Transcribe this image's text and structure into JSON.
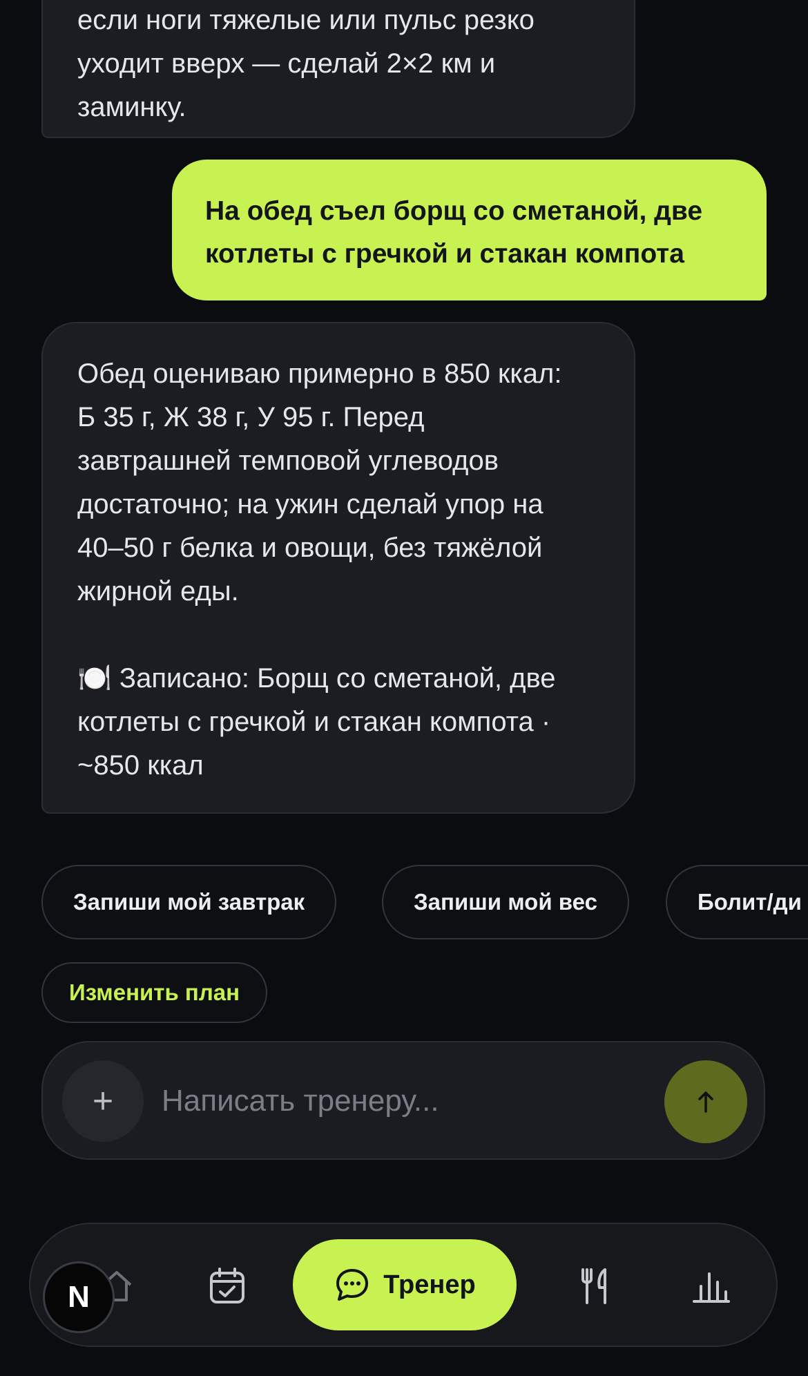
{
  "chat": {
    "bot_message_1_lines": [
      "если ноги тяжелые или пульс резко",
      "уходит вверх — сделай 2×2 км и",
      "заминку."
    ],
    "user_message_lines": [
      "На обед съел борщ со сметаной, две",
      "котлеты с гречкой и стакан компота"
    ],
    "bot_message_2_lines": [
      "Обед оцениваю примерно в 850 ккал:",
      "Б 35 г, Ж 38 г, У 95 г. Перед",
      "завтрашней темповой углеводов",
      "достаточно; на ужин сделай упор на",
      "40–50 г белка и овощи, без тяжёлой",
      "жирной еды."
    ],
    "logged_lines": [
      "🍽️ Записано: Борщ со сметаной, две",
      "котлеты с гречкой и стакан компота ·",
      "~850 ккал"
    ]
  },
  "quick_replies": [
    "Запиши мой завтрак",
    "Запиши мой вес",
    "Болит/ди"
  ],
  "edit_plan_label": "Изменить план",
  "composer": {
    "plus_label": "+",
    "placeholder": "Написать тренеру..."
  },
  "tabbar": {
    "avatar_letter": "N",
    "active_tab_label": "Тренер",
    "icons": [
      "home-icon",
      "calendar-check-icon",
      "chat-icon",
      "fork-knife-icon",
      "bar-chart-icon"
    ]
  },
  "colors": {
    "accent": "#c8f252",
    "background": "#0b0c0f",
    "bubble": "#1c1d22",
    "send_button": "#5e6b1f"
  }
}
